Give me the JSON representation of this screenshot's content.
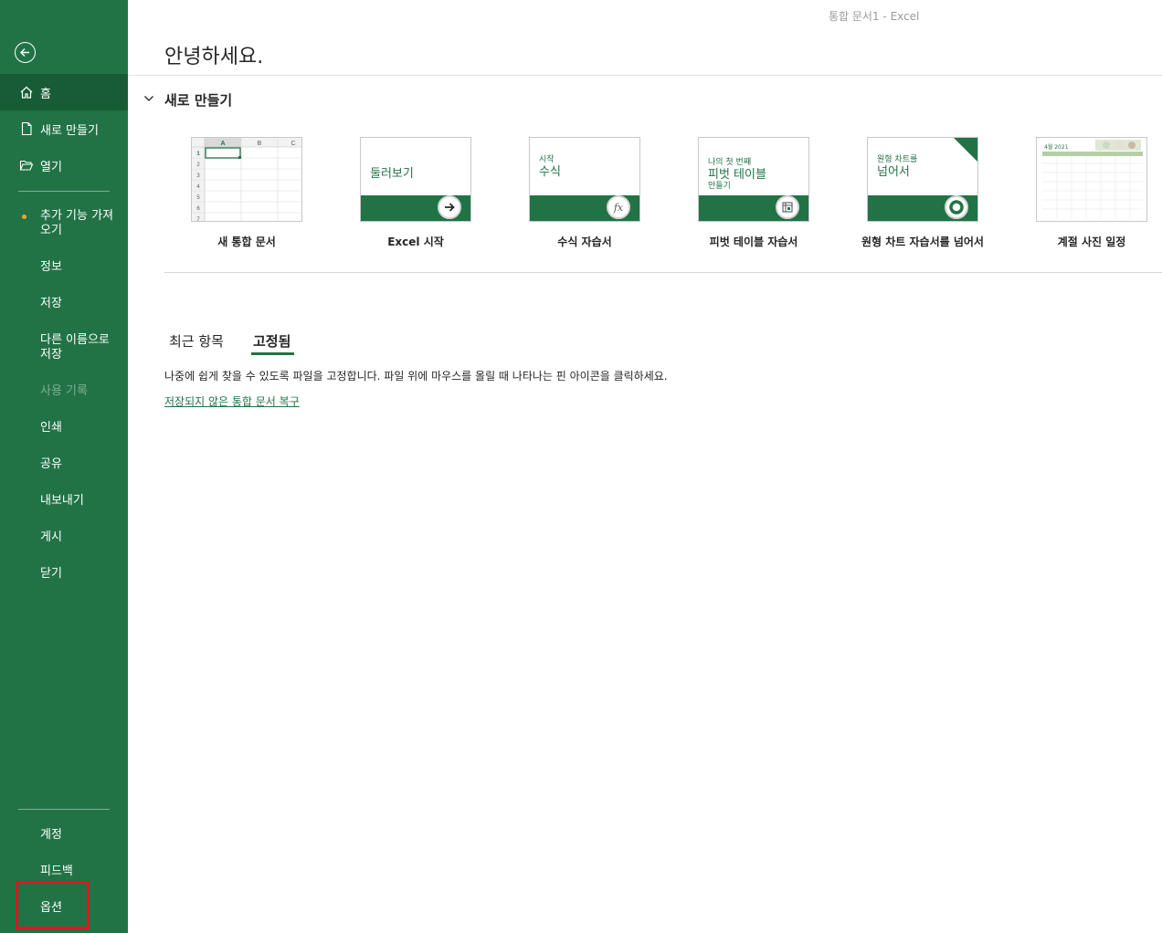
{
  "window_title": "통합 문서1  -  Excel",
  "sidebar": {
    "top_items": [
      {
        "label": "홈",
        "icon": "home-icon"
      },
      {
        "label": "새로 만들기",
        "icon": "new-document-icon"
      },
      {
        "label": "열기",
        "icon": "open-folder-icon"
      }
    ],
    "items": [
      {
        "label": "추가 기능 가져\n오기"
      },
      {
        "label": "정보"
      },
      {
        "label": "저장"
      },
      {
        "label": "다른 이름으로\n저장"
      },
      {
        "label": "사용 기록"
      },
      {
        "label": "인쇄"
      },
      {
        "label": "공유"
      },
      {
        "label": "내보내기"
      },
      {
        "label": "게시"
      },
      {
        "label": "닫기"
      }
    ],
    "bottom_items": [
      {
        "label": "계정"
      },
      {
        "label": "피드백"
      },
      {
        "label": "옵션"
      }
    ]
  },
  "main": {
    "greeting": "안녕하세요.",
    "new_section_title": "새로 만들기",
    "templates": [
      {
        "label": "새 통합 문서"
      },
      {
        "label": "Excel 시작",
        "thumb_text": "둘러보기"
      },
      {
        "label": "수식 자습서",
        "thumb_small": "시작",
        "thumb_text": "수식"
      },
      {
        "label": "피벗 테이블 자습서",
        "thumb_small": "나의 첫 번째",
        "thumb_text": "피벗 테이블",
        "thumb_small2": "만들기"
      },
      {
        "label": "원형 차트 자습서를 넘어서",
        "thumb_small": "원형 차트를",
        "thumb_text": "넘어서"
      },
      {
        "label": "계절 사진 일정",
        "thumb_small": "4월 2021"
      }
    ],
    "tabs": [
      {
        "label": "최근 항목"
      },
      {
        "label": "고정됨"
      }
    ],
    "pinned_description": "나중에 쉽게 찾을 수 있도록 파일을 고정합니다. 파일 위에 마우스를 올릴 때 나타나는 핀 아이콘을 클릭하세요.",
    "recover_link": "저장되지 않은 통합 문서 복구",
    "sheet_columns": [
      "A",
      "B",
      "C"
    ],
    "sheet_rows": [
      "1",
      "2",
      "3",
      "4",
      "5",
      "6",
      "7"
    ]
  },
  "colors": {
    "accent": "#217346",
    "accent_dark": "#185c37",
    "highlight_box": "#e81123"
  }
}
